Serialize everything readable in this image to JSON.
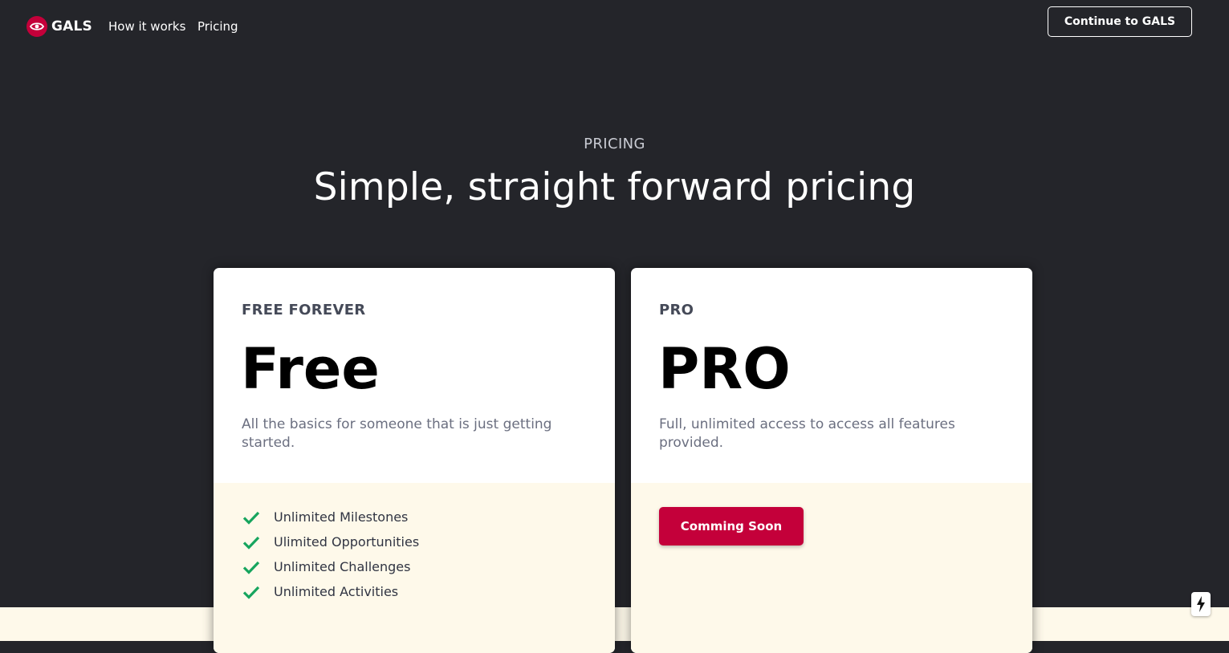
{
  "nav": {
    "brand": "GALS",
    "links": [
      {
        "label": "How it works"
      },
      {
        "label": "Pricing"
      }
    ],
    "cta": "Continue to GALS"
  },
  "hero": {
    "eyebrow": "PRICING",
    "title": "Simple, straight forward pricing"
  },
  "plans": [
    {
      "label": "FREE FOREVER",
      "price": "Free",
      "description": "All the basics for someone that is just getting started.",
      "features": [
        "Unlimited Milestones",
        "Ulimited Opportunities",
        "Unlimited Challenges",
        "Unlimited Activities"
      ]
    },
    {
      "label": "PRO",
      "price": "PRO",
      "description": "Full, unlimited access to access all features provided.",
      "button": "Comming Soon"
    }
  ],
  "icons": {
    "brand": "eye-icon",
    "feature": "check-icon",
    "floating": "bolt-icon"
  },
  "colors": {
    "background": "#24252a",
    "accent": "#c4003a",
    "check": "#17a55e",
    "panel": "#fef9ea"
  }
}
